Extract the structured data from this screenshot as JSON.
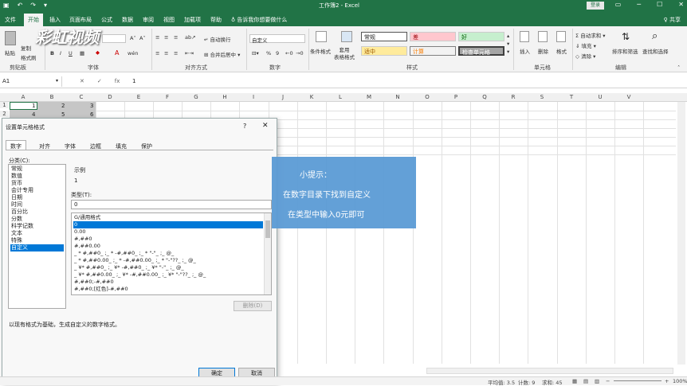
{
  "app": {
    "title": "工作簿2  -  Excel",
    "login": "登录",
    "share": "♀ 共享",
    "tell_me": "告诉我你想要做什么"
  },
  "tabs": [
    "文件",
    "开始",
    "插入",
    "页面布局",
    "公式",
    "数据",
    "审阅",
    "视图",
    "加载项",
    "帮助"
  ],
  "ribbon": {
    "clipboard": {
      "paste": "粘贴",
      "copy": "复制",
      "painter": "格式刷",
      "group": "剪贴板"
    },
    "font": {
      "group": "字体",
      "bold": "B",
      "italic": "I",
      "underline": "U"
    },
    "alignment": {
      "group": "对齐方式",
      "wrap": "自动换行",
      "merge": "合并后居中"
    },
    "number": {
      "group": "数字",
      "format": "自定义",
      "percent": "%"
    },
    "styles": {
      "group": "样式",
      "cond": "条件格式",
      "table": "套用\n表格格式",
      "normal": "常规",
      "bad": "差",
      "good": "好",
      "neutral": "适中",
      "calc": "计算",
      "check": "检查单元格"
    },
    "cells": {
      "group": "单元格",
      "insert": "插入",
      "delete": "删除",
      "format": "格式"
    },
    "editing": {
      "group": "编辑",
      "autosum": "自动求和",
      "fill": "填充",
      "clear": "清除",
      "sort": "排序和筛选",
      "find": "查找和选择"
    }
  },
  "formula_bar": {
    "name_box": "A1",
    "fx": "fx",
    "value": "1",
    "cancel": "✕",
    "enter": "✓"
  },
  "columns": [
    "A",
    "B",
    "C",
    "D",
    "E",
    "F",
    "G",
    "H",
    "I",
    "J",
    "K",
    "L",
    "M",
    "N",
    "O",
    "P",
    "Q",
    "R",
    "S",
    "T",
    "U",
    "V"
  ],
  "rows": [
    "1",
    "2"
  ],
  "cells": [
    [
      "1",
      "2",
      "3"
    ],
    [
      "4",
      "5",
      "6"
    ]
  ],
  "dialog": {
    "title": "设置单元格格式",
    "help": "?",
    "close": "✕",
    "tabs": [
      "数字",
      "对齐",
      "字体",
      "边框",
      "填充",
      "保护"
    ],
    "category_label": "分类(C):",
    "categories": [
      "常规",
      "数值",
      "货币",
      "会计专用",
      "日期",
      "时间",
      "百分比",
      "分数",
      "科学记数",
      "文本",
      "特殊",
      "自定义"
    ],
    "selected_category": "自定义",
    "sample_label": "示例",
    "sample_value": "1",
    "type_label": "类型(T):",
    "type_value": "0",
    "formats": [
      "G/通用格式",
      "0",
      "0.00",
      "#,##0",
      "#,##0.00",
      "_ * #,##0_ ;_ * -#,##0_ ;_ * \"-\"_ ;_ @_",
      "_ * #,##0.00_ ;_ * -#,##0.00_ ;_ * \"-\"??_ ;_ @_",
      "_ ¥* #,##0_ ;_ ¥* -#,##0_ ;_ ¥* \"-\"_ ;_ @_",
      "_ ¥* #,##0.00_ ;_ ¥* -#,##0.00_ ;_ ¥* \"-\"??_ ;_ @_",
      "#,##0;-#,##0",
      "#,##0;[红色]-#,##0"
    ],
    "delete_label": "删除(D)",
    "description": "以现有格式为基础，生成自定义的数字格式。",
    "ok": "确定",
    "cancel": "取消"
  },
  "tip": {
    "title": "小提示：",
    "line1": "在数字目录下找到自定义",
    "line2": "在类型中输入0元即可"
  },
  "status": {
    "average": "平均值: 3.5",
    "count": "计数: 9",
    "sum": "求和: 45",
    "zoom": "100%"
  },
  "watermark": "彩虹视频"
}
